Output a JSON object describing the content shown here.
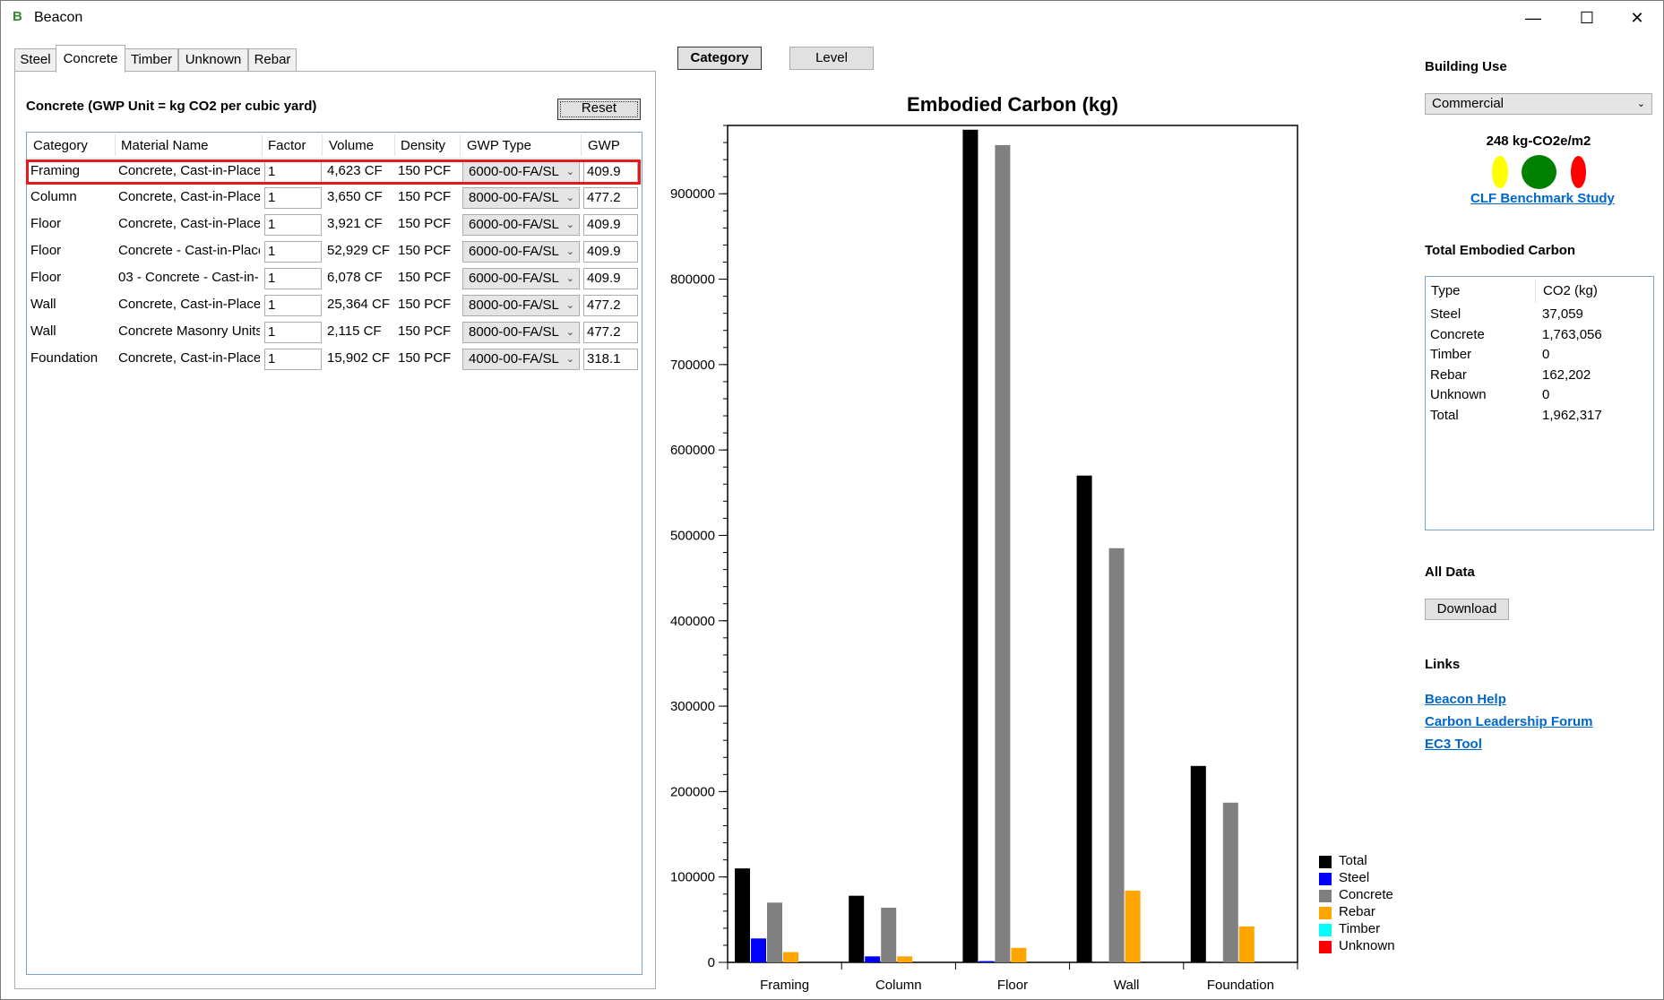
{
  "window": {
    "title": "Beacon",
    "app_icon_letter": "B",
    "minimize": "—",
    "maximize": "☐",
    "close": "✕"
  },
  "tabs": [
    "Steel",
    "Concrete",
    "Timber",
    "Unknown",
    "Rebar"
  ],
  "active_tab": "Concrete",
  "panel": {
    "title": "Concrete (GWP Unit = kg CO2 per cubic yard)",
    "reset_label": "Reset",
    "columns": [
      "Category",
      "Material Name",
      "Factor",
      "Volume",
      "Density",
      "GWP Type",
      "GWP"
    ],
    "rows": [
      {
        "category": "Framing",
        "material": "Concrete, Cast-in-Place",
        "factor": "1",
        "volume": "4,623 CF",
        "density": "150 PCF",
        "gwp_type": "6000-00-FA/SL",
        "gwp": "409.9"
      },
      {
        "category": "Column",
        "material": "Concrete, Cast-in-Place",
        "factor": "1",
        "volume": "3,650 CF",
        "density": "150 PCF",
        "gwp_type": "8000-00-FA/SL",
        "gwp": "477.2"
      },
      {
        "category": "Floor",
        "material": "Concrete, Cast-in-Place",
        "factor": "1",
        "volume": "3,921 CF",
        "density": "150 PCF",
        "gwp_type": "6000-00-FA/SL",
        "gwp": "409.9"
      },
      {
        "category": "Floor",
        "material": "Concrete - Cast-in-Place",
        "factor": "1",
        "volume": "52,929 CF",
        "density": "150 PCF",
        "gwp_type": "6000-00-FA/SL",
        "gwp": "409.9"
      },
      {
        "category": "Floor",
        "material": "03 - Concrete - Cast-in-",
        "factor": "1",
        "volume": "6,078 CF",
        "density": "150 PCF",
        "gwp_type": "6000-00-FA/SL",
        "gwp": "409.9"
      },
      {
        "category": "Wall",
        "material": "Concrete, Cast-in-Place",
        "factor": "1",
        "volume": "25,364 CF",
        "density": "150 PCF",
        "gwp_type": "8000-00-FA/SL",
        "gwp": "477.2"
      },
      {
        "category": "Wall",
        "material": "Concrete Masonry Units",
        "factor": "1",
        "volume": "2,115 CF",
        "density": "150 PCF",
        "gwp_type": "8000-00-FA/SL",
        "gwp": "477.2"
      },
      {
        "category": "Foundation",
        "material": "Concrete, Cast-in-Place",
        "factor": "1",
        "volume": "15,902 CF",
        "density": "150 PCF",
        "gwp_type": "4000-00-FA/SL",
        "gwp": "318.1"
      }
    ]
  },
  "view_buttons": {
    "category": "Category",
    "level": "Level"
  },
  "chart_data": {
    "type": "bar",
    "title": "Embodied Carbon (kg)",
    "xlabel": "",
    "ylabel": "",
    "categories": [
      "Framing",
      "Column",
      "Floor",
      "Wall",
      "Foundation"
    ],
    "ylim": [
      0,
      980000
    ],
    "yticks": [
      0,
      100000,
      200000,
      300000,
      400000,
      500000,
      600000,
      700000,
      800000,
      900000
    ],
    "grid": false,
    "legend_position": "bottom-right",
    "series": [
      {
        "name": "Total",
        "color": "#000000",
        "values": [
          110000,
          78000,
          975000,
          570000,
          230000
        ]
      },
      {
        "name": "Steel",
        "color": "#0000ff",
        "values": [
          28000,
          7000,
          1500,
          0,
          0
        ]
      },
      {
        "name": "Concrete",
        "color": "#808080",
        "values": [
          70000,
          64000,
          957000,
          485000,
          187000
        ]
      },
      {
        "name": "Rebar",
        "color": "#ffa500",
        "values": [
          12000,
          7000,
          17000,
          84000,
          42000
        ]
      },
      {
        "name": "Timber",
        "color": "#00ffff",
        "values": [
          0,
          0,
          0,
          0,
          0
        ]
      },
      {
        "name": "Unknown",
        "color": "#ff0000",
        "values": [
          0,
          0,
          0,
          0,
          0
        ]
      }
    ]
  },
  "right": {
    "building_use_label": "Building Use",
    "building_use_value": "Commercial",
    "benchmark_value": "248 kg-CO2e/m2",
    "benchmark_link": "CLF Benchmark Study",
    "indicator_colors": [
      "#ffff00",
      "#008000",
      "#ff0000"
    ],
    "total_label": "Total Embodied Carbon",
    "total_columns": [
      "Type",
      "CO2 (kg)"
    ],
    "total_rows": [
      {
        "type": "Steel",
        "value": "37,059"
      },
      {
        "type": "Concrete",
        "value": "1,763,056"
      },
      {
        "type": "Timber",
        "value": "0"
      },
      {
        "type": "Rebar",
        "value": "162,202"
      },
      {
        "type": "Unknown",
        "value": "0"
      },
      {
        "type": "Total",
        "value": "1,962,317"
      }
    ],
    "all_data_label": "All Data",
    "download_label": "Download",
    "links_label": "Links",
    "links": [
      "Beacon Help",
      "Carbon Leadership Forum",
      "EC3 Tool"
    ]
  }
}
